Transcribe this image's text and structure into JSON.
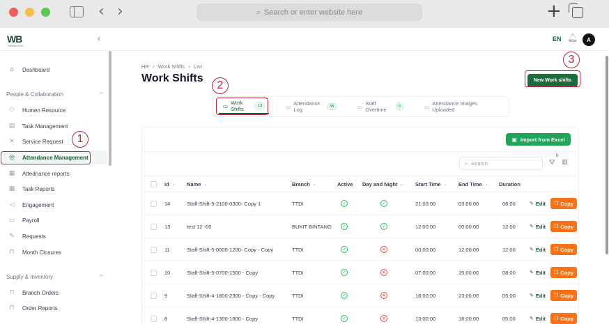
{
  "browser": {
    "url_placeholder": "Search or enter website here"
  },
  "topbar": {
    "logo": "WB",
    "logo_sub": "WORKBOOK MY",
    "language": "EN",
    "avatar_initial": "A"
  },
  "sidebar": {
    "items": [
      {
        "label": "Dashboard",
        "icon": "home-icon"
      },
      {
        "label": "Humen Resource",
        "icon": "people-icon"
      },
      {
        "label": "Task Management",
        "icon": "clipboard-icon"
      },
      {
        "label": "Service Request",
        "icon": "tools-icon"
      },
      {
        "label": "Attendance Management",
        "icon": "fingerprint-icon"
      },
      {
        "label": "Attednance reports",
        "icon": "report-icon"
      },
      {
        "label": "Task Reports",
        "icon": "report-icon"
      },
      {
        "label": "Engagement",
        "icon": "megaphone-icon"
      },
      {
        "label": "Payroll",
        "icon": "wallet-icon"
      },
      {
        "label": "Requests",
        "icon": "pen-icon"
      },
      {
        "label": "Month Closures",
        "icon": "lock-icon"
      },
      {
        "label": "Branch Orders",
        "icon": "bag-icon"
      },
      {
        "label": "Order Reports",
        "icon": "bag-icon"
      }
    ],
    "sections": [
      {
        "label": "People & Collaboration"
      },
      {
        "label": "Supply & Inventory"
      }
    ]
  },
  "main": {
    "breadcrumb": [
      "HR",
      "Work Shifts",
      "List"
    ],
    "title": "Work Shifts",
    "new_button": "New Work shifts",
    "tabs": [
      {
        "label": "Work Shifts",
        "badge": "13"
      },
      {
        "label": "Attendance Log",
        "badge": "38"
      },
      {
        "label": "Staff Overtime",
        "badge": "0"
      },
      {
        "label": "Attendance Images Uploaded",
        "badge": ""
      }
    ],
    "import_button": "Import from Excel",
    "search_placeholder": "Search",
    "filter_count": "0",
    "columns": [
      "id",
      "Name",
      "Branch",
      "Active",
      "Day and Night",
      "Start Time",
      "End Time",
      "Duration"
    ],
    "edit_label": "Edit",
    "copy_label": "Copy",
    "rows": [
      {
        "id": "14",
        "name": "Staff-Shift-5-2100-0300- Copy 1",
        "branch": "TTDI",
        "active": true,
        "day_night": true,
        "start": "21:00:00",
        "end": "03:00:00",
        "duration": "06:00"
      },
      {
        "id": "13",
        "name": "test 12 -00",
        "branch": "BUKIT BINTANG",
        "active": true,
        "day_night": true,
        "start": "12:00:00",
        "end": "00:00:00",
        "duration": "12:00"
      },
      {
        "id": "11",
        "name": "Staff-Shift-5-0000-1200- Copy - Copy",
        "branch": "TTDI",
        "active": true,
        "day_night": false,
        "start": "00:00:00",
        "end": "12:00:00",
        "duration": "12:00"
      },
      {
        "id": "10",
        "name": "Staff-Shift-5-0700-1500 - Copy",
        "branch": "TTDI",
        "active": true,
        "day_night": false,
        "start": "07:00:00",
        "end": "15:00:00",
        "duration": "08:00"
      },
      {
        "id": "9",
        "name": "Staff-Shift-4-1800-2300 - Copy - Copy",
        "branch": "TTDI",
        "active": true,
        "day_night": false,
        "start": "18:00:00",
        "end": "23:00:00",
        "duration": "05:00"
      },
      {
        "id": "8",
        "name": "Staff-Shift-4-1300-1800 - Copy",
        "branch": "TTDI",
        "active": true,
        "day_night": false,
        "start": "13:00:00",
        "end": "18:00:00",
        "duration": "05:00"
      }
    ]
  },
  "annotations": [
    "1",
    "2",
    "3"
  ],
  "colors": {
    "brand_green": "#1f6b3c",
    "import_green": "#22a55a",
    "copy_orange": "#f97316",
    "annotation_red": "#c0223b"
  }
}
